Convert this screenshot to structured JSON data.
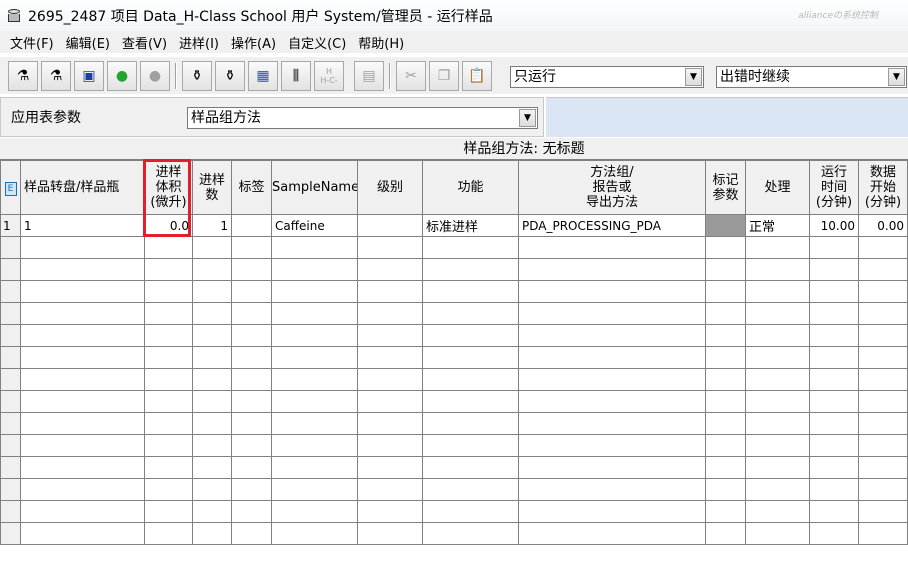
{
  "window": {
    "title": "2695_2487 项目 Data_H-Class School 用户 System/管理员 - 运行样品",
    "title_right": "allianceの系统控制"
  },
  "menu": [
    "文件(F)",
    "编辑(E)",
    "查看(V)",
    "进样(I)",
    "操作(A)",
    "自定义(C)",
    "帮助(H)"
  ],
  "toolbar": {
    "combo_run": "只运行",
    "combo_error": "出错时继续",
    "h_button": "H\nH-C-"
  },
  "params": {
    "label": "应用表参数",
    "select_value": "样品组方法"
  },
  "grid": {
    "caption": "样品组方法: 无标题",
    "headers": {
      "vial": "样品转盘/样品瓶",
      "volume": "进样\n体积\n(微升)",
      "injections": "进样\n数",
      "label": "标签",
      "sample_name": "SampleName",
      "level": "级别",
      "function": "功能",
      "method": "方法组/\n报告或\n导出方法",
      "mark_params": "标记\n参数",
      "processing": "处理",
      "run_time": "运行\n时间\n(分钟)",
      "data_start": "数据\n开始\n(分钟)"
    },
    "rows": [
      {
        "index": "1",
        "vial": "1",
        "volume": "0.0",
        "injections": "1",
        "label": "",
        "sample_name": "Caffeine",
        "level": "",
        "function": "标准进样",
        "method": "PDA_PROCESSING_PDA",
        "mark_params": "",
        "processing": "正常",
        "run_time": "10.00",
        "data_start": "0.00"
      }
    ],
    "empty_row_count": 14
  }
}
